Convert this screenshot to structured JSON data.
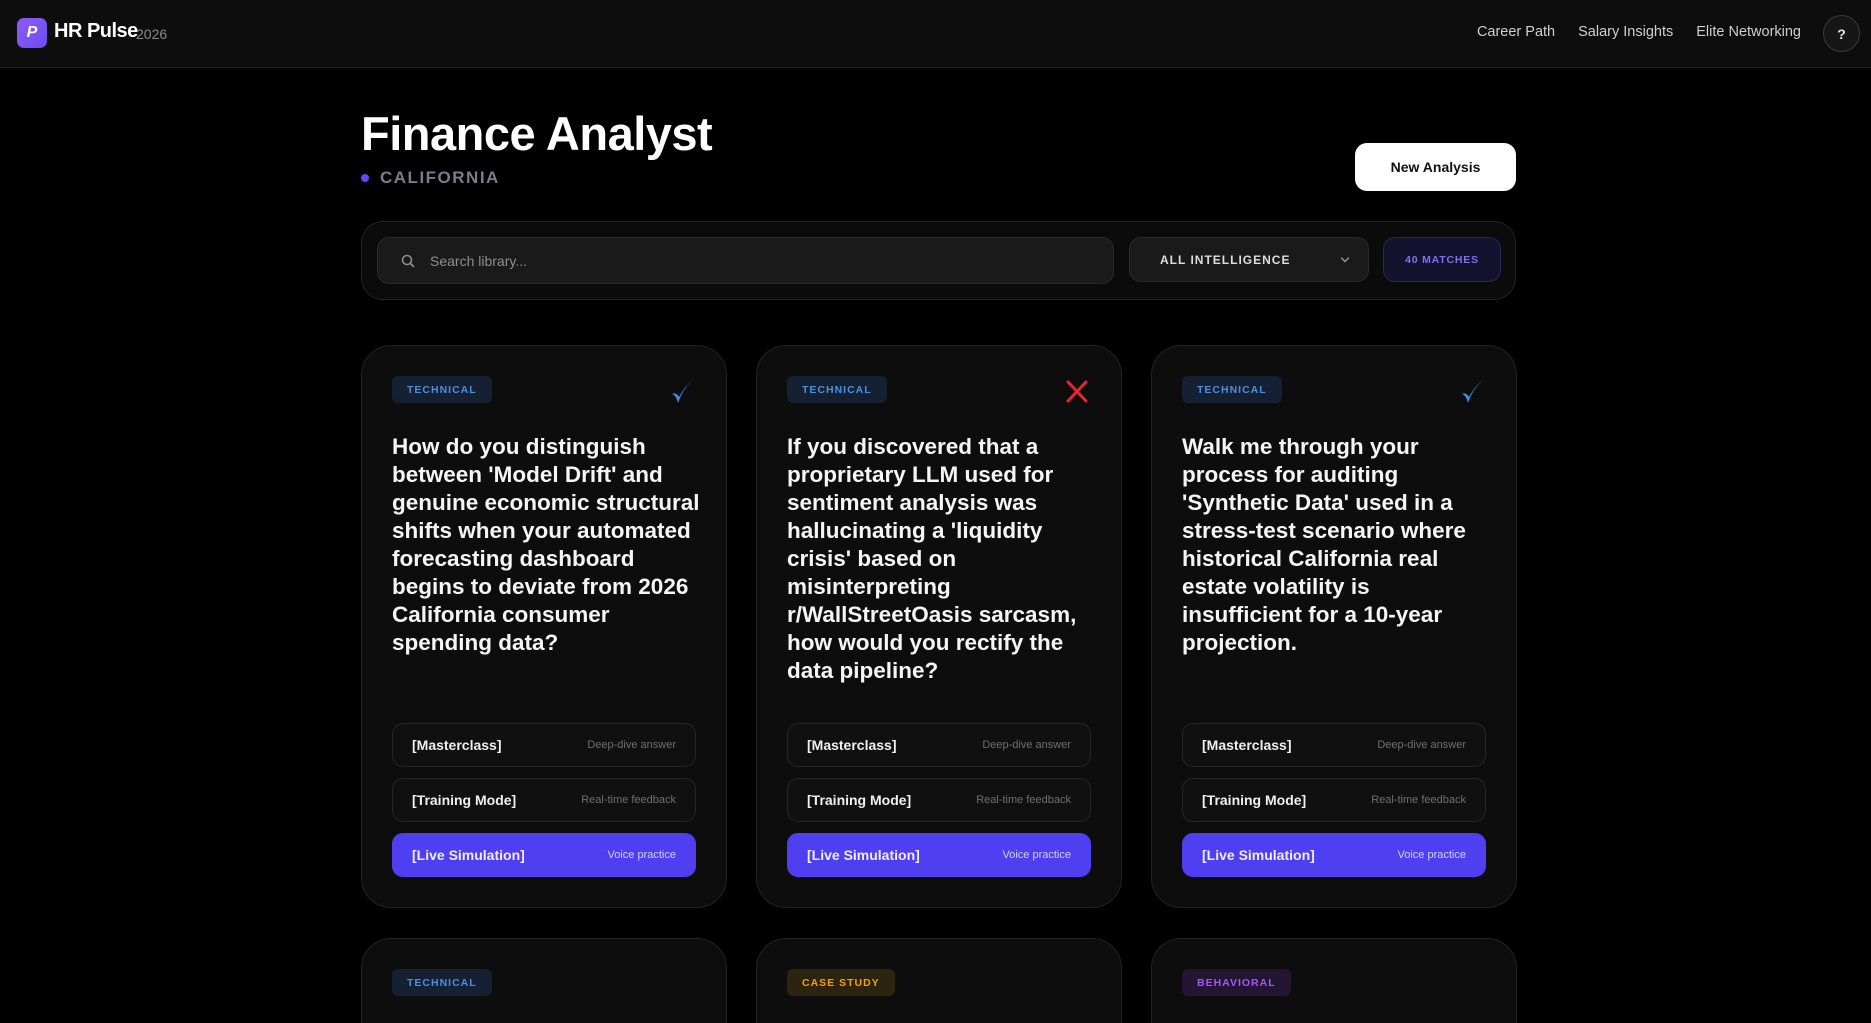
{
  "nav": {
    "logo_letter": "P",
    "brand": "HR Pulse",
    "year": "2026",
    "links": [
      "Career Path",
      "Salary Insights",
      "Elite Networking"
    ],
    "help_label": "?"
  },
  "header": {
    "title": "Finance Analyst",
    "location": "CALIFORNIA",
    "new_analysis_label": "New Analysis"
  },
  "search": {
    "placeholder": "Search library...",
    "filter_value": "ALL INTELLIGENCE",
    "match_count": "40 MATCHES"
  },
  "mode_buttons": {
    "masterclass": {
      "label": "[Masterclass]",
      "sub": "Deep-dive answer"
    },
    "training": {
      "label": "[Training Mode]",
      "sub": "Real-time feedback"
    },
    "live": {
      "label": "[Live Simulation]",
      "sub": "Voice practice"
    }
  },
  "cards": [
    {
      "tag": "TECHNICAL",
      "status": "check",
      "question": "How do you distinguish between 'Model Drift' and genuine economic structural shifts when your automated forecasting dashboard begins to deviate from 2026 California consumer spending data?"
    },
    {
      "tag": "TECHNICAL",
      "status": "cross",
      "question": "If you discovered that a proprietary LLM used for sentiment analysis was hallucinating a 'liquidity crisis' based on misinterpreting r/WallStreetOasis sarcasm, how would you rectify the data pipeline?"
    },
    {
      "tag": "TECHNICAL",
      "status": "check",
      "question": "Walk me through your process for auditing 'Synthetic Data' used in a stress-test scenario where historical California real estate volatility is insufficient for a 10-year projection."
    },
    {
      "tag": "TECHNICAL"
    },
    {
      "tag": "CASE STUDY"
    },
    {
      "tag": "BEHAVIORAL"
    }
  ],
  "colors": {
    "accent": "#4f3ff0",
    "check": "#3b8fe8",
    "cross": "#e5282f",
    "technical": "#4a90e2",
    "case_study": "#f59e0b",
    "behavioral": "#a855f7"
  }
}
